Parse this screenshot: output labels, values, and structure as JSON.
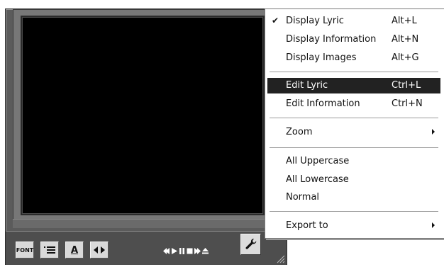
{
  "player": {
    "toolbar": {
      "font_button_text": "FONT",
      "list_button_icon": "list-icon",
      "letter_button_text": "A",
      "images_button_icon": "arrows-icon"
    },
    "transport_icons": [
      "rewind-icon",
      "play-icon",
      "pause-icon",
      "stop-icon",
      "fast-forward-icon",
      "eject-icon"
    ],
    "settings_icon": "wrench-icon"
  },
  "menu": {
    "items": [
      {
        "label": "Display Lyric",
        "shortcut": "Alt+L",
        "checked": "✔"
      },
      {
        "label": "Display Information",
        "shortcut": "Alt+N"
      },
      {
        "label": "Display Images",
        "shortcut": "Alt+G"
      },
      {
        "label": "Edit Lyric",
        "shortcut": "Ctrl+L",
        "highlighted": true
      },
      {
        "label": "Edit Information",
        "shortcut": "Ctrl+N"
      },
      {
        "label": "Zoom",
        "submenu": true
      },
      {
        "label": "All Uppercase"
      },
      {
        "label": "All Lowercase"
      },
      {
        "label": "Normal"
      },
      {
        "label": "Export to",
        "submenu": true
      }
    ],
    "highlight_color": "#222222"
  }
}
